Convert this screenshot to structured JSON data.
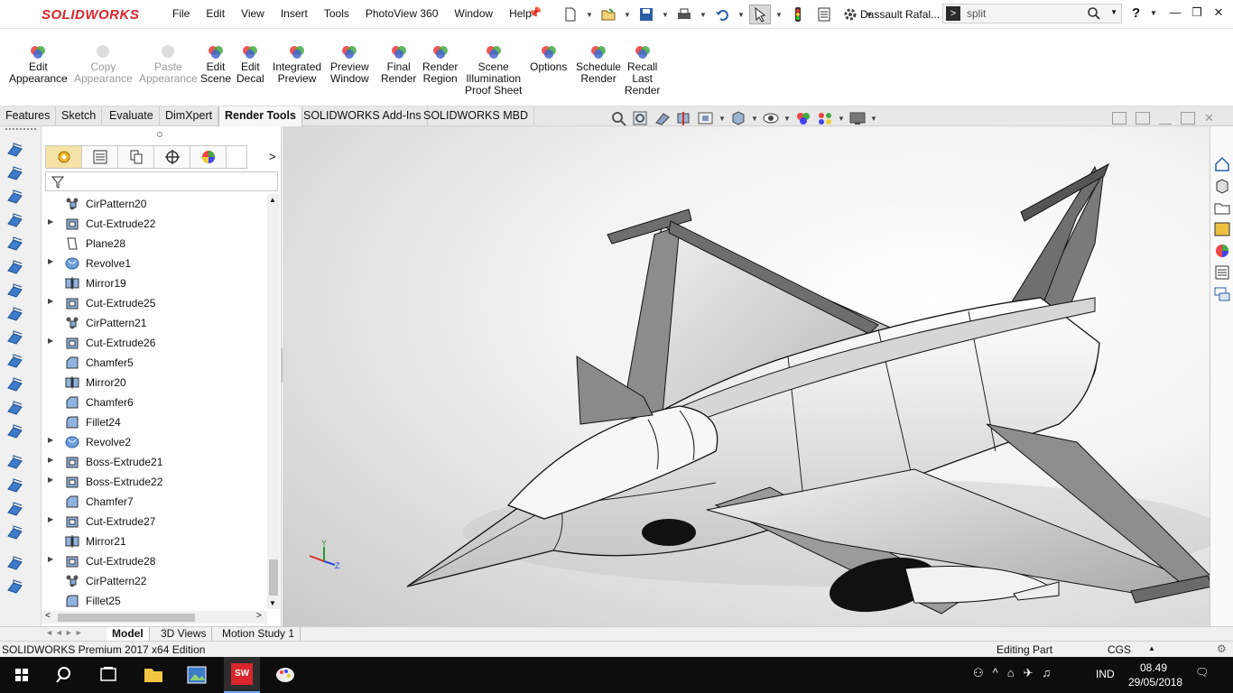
{
  "app": {
    "logo_text": "SOLIDWORKS",
    "menu": [
      "File",
      "Edit",
      "View",
      "Insert",
      "Tools",
      "PhotoView 360",
      "Window",
      "Help"
    ],
    "user": "Dassault Rafal...",
    "search_value": "split"
  },
  "ribbon": [
    {
      "label1": "Edit",
      "label2": "Appearance",
      "disabled": false,
      "icon": "edit-appearance-icon"
    },
    {
      "label1": "Copy",
      "label2": "Appearance",
      "disabled": true,
      "icon": "copy-appearance-icon"
    },
    {
      "label1": "Paste",
      "label2": "Appearance",
      "disabled": true,
      "icon": "paste-appearance-icon"
    },
    {
      "label1": "Edit",
      "label2": "Scene",
      "disabled": false,
      "icon": "edit-scene-icon"
    },
    {
      "label1": "Edit",
      "label2": "Decal",
      "disabled": false,
      "icon": "edit-decal-icon"
    },
    {
      "label1": "Integrated",
      "label2": "Preview",
      "disabled": false,
      "icon": "integrated-preview-icon"
    },
    {
      "label1": "Preview",
      "label2": "Window",
      "disabled": false,
      "icon": "preview-window-icon"
    },
    {
      "label1": "Final",
      "label2": "Render",
      "disabled": false,
      "icon": "final-render-icon"
    },
    {
      "label1": "Render",
      "label2": "Region",
      "disabled": false,
      "icon": "render-region-icon"
    },
    {
      "label1": "Scene",
      "label2": "Illumination",
      "label3": "Proof Sheet",
      "disabled": false,
      "icon": "scene-illumination-icon"
    },
    {
      "label1": "Options",
      "label2": "",
      "disabled": false,
      "icon": "options-icon"
    },
    {
      "label1": "Schedule",
      "label2": "Render",
      "disabled": false,
      "icon": "schedule-render-icon"
    },
    {
      "label1": "Recall",
      "label2": "Last",
      "label3": "Render",
      "disabled": false,
      "icon": "recall-last-render-icon"
    }
  ],
  "tabs": [
    "Features",
    "Sketch",
    "Evaluate",
    "DimXpert",
    "Render Tools",
    "SOLIDWORKS Add-Ins",
    "SOLIDWORKS MBD"
  ],
  "active_tab": "Render Tools",
  "tree": [
    {
      "name": "CirPattern20",
      "type": "pattern",
      "expandable": false
    },
    {
      "name": "Cut-Extrude22",
      "type": "extrude",
      "expandable": true
    },
    {
      "name": "Plane28",
      "type": "plane",
      "expandable": false
    },
    {
      "name": "Revolve1",
      "type": "revolve",
      "expandable": true
    },
    {
      "name": "Mirror19",
      "type": "mirror",
      "expandable": false
    },
    {
      "name": "Cut-Extrude25",
      "type": "extrude",
      "expandable": true
    },
    {
      "name": "CirPattern21",
      "type": "pattern",
      "expandable": false
    },
    {
      "name": "Cut-Extrude26",
      "type": "extrude",
      "expandable": true
    },
    {
      "name": "Chamfer5",
      "type": "chamfer",
      "expandable": false
    },
    {
      "name": "Mirror20",
      "type": "mirror",
      "expandable": false
    },
    {
      "name": "Chamfer6",
      "type": "chamfer",
      "expandable": false
    },
    {
      "name": "Fillet24",
      "type": "fillet",
      "expandable": false
    },
    {
      "name": "Revolve2",
      "type": "revolve",
      "expandable": true
    },
    {
      "name": "Boss-Extrude21",
      "type": "extrude",
      "expandable": true
    },
    {
      "name": "Boss-Extrude22",
      "type": "extrude",
      "expandable": true
    },
    {
      "name": "Chamfer7",
      "type": "chamfer",
      "expandable": false
    },
    {
      "name": "Cut-Extrude27",
      "type": "extrude",
      "expandable": true
    },
    {
      "name": "Mirror21",
      "type": "mirror",
      "expandable": false
    },
    {
      "name": "Cut-Extrude28",
      "type": "extrude",
      "expandable": true
    },
    {
      "name": "CirPattern22",
      "type": "pattern",
      "expandable": false
    },
    {
      "name": "Fillet25",
      "type": "fillet",
      "expandable": false
    }
  ],
  "bottom_tabs": [
    "Model",
    "3D Views",
    "Motion Study 1"
  ],
  "active_bottom_tab": "Model",
  "status": {
    "text": "SOLIDWORKS Premium 2017 x64 Edition",
    "mode": "Editing Part",
    "units": "CGS"
  },
  "taskbar": {
    "lang": "IND",
    "time": "08.49",
    "date": "29/05/2018",
    "sw_badge": "SW"
  },
  "colors": {
    "accent": "#d8262b",
    "taskbar": "#0d0d0d",
    "active_tab": "#f7f7f7",
    "selection": "#f5e3a6"
  }
}
